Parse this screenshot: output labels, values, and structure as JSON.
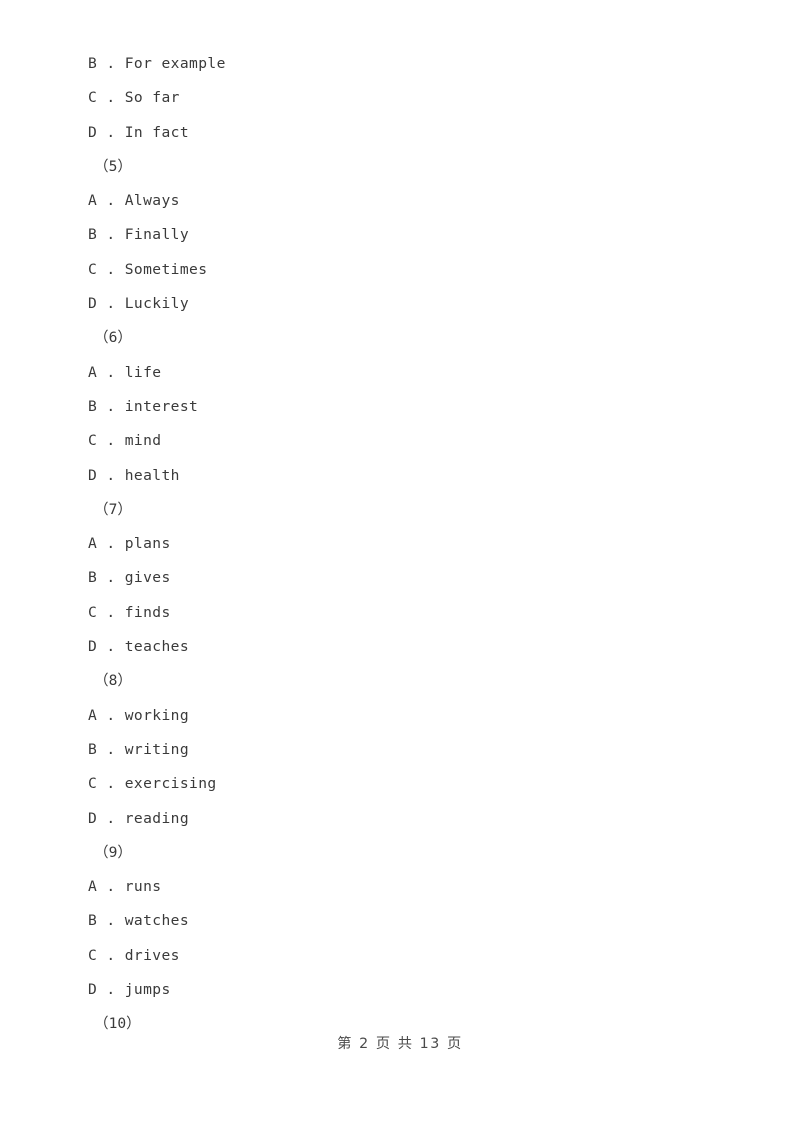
{
  "document": {
    "background_color": "#ffffff",
    "text_color": "#3a3a3a"
  },
  "blocks": [
    {
      "kind": "option",
      "letter": "B",
      "text": "For example",
      "full": "B . For example"
    },
    {
      "kind": "option",
      "letter": "C",
      "text": "So far",
      "full": "C . So far"
    },
    {
      "kind": "option",
      "letter": "D",
      "text": "In fact",
      "full": "D . In fact"
    },
    {
      "kind": "question",
      "number": "5",
      "full": "（5）"
    },
    {
      "kind": "option",
      "letter": "A",
      "text": "Always",
      "full": "A . Always"
    },
    {
      "kind": "option",
      "letter": "B",
      "text": "Finally",
      "full": "B . Finally"
    },
    {
      "kind": "option",
      "letter": "C",
      "text": "Sometimes",
      "full": "C . Sometimes"
    },
    {
      "kind": "option",
      "letter": "D",
      "text": "Luckily",
      "full": "D . Luckily"
    },
    {
      "kind": "question",
      "number": "6",
      "full": "（6）"
    },
    {
      "kind": "option",
      "letter": "A",
      "text": "life",
      "full": "A . life"
    },
    {
      "kind": "option",
      "letter": "B",
      "text": "interest",
      "full": "B . interest"
    },
    {
      "kind": "option",
      "letter": "C",
      "text": "mind",
      "full": "C . mind"
    },
    {
      "kind": "option",
      "letter": "D",
      "text": "health",
      "full": "D . health"
    },
    {
      "kind": "question",
      "number": "7",
      "full": "（7）"
    },
    {
      "kind": "option",
      "letter": "A",
      "text": "plans",
      "full": "A . plans"
    },
    {
      "kind": "option",
      "letter": "B",
      "text": "gives",
      "full": "B . gives"
    },
    {
      "kind": "option",
      "letter": "C",
      "text": "finds",
      "full": "C . finds"
    },
    {
      "kind": "option",
      "letter": "D",
      "text": "teaches",
      "full": "D . teaches"
    },
    {
      "kind": "question",
      "number": "8",
      "full": "（8）"
    },
    {
      "kind": "option",
      "letter": "A",
      "text": "working",
      "full": "A . working"
    },
    {
      "kind": "option",
      "letter": "B",
      "text": "writing",
      "full": "B . writing"
    },
    {
      "kind": "option",
      "letter": "C",
      "text": "exercising",
      "full": "C . exercising"
    },
    {
      "kind": "option",
      "letter": "D",
      "text": "reading",
      "full": "D . reading"
    },
    {
      "kind": "question",
      "number": "9",
      "full": "（9）"
    },
    {
      "kind": "option",
      "letter": "A",
      "text": "runs",
      "full": "A . runs"
    },
    {
      "kind": "option",
      "letter": "B",
      "text": "watches",
      "full": "B . watches"
    },
    {
      "kind": "option",
      "letter": "C",
      "text": "drives",
      "full": "C . drives"
    },
    {
      "kind": "option",
      "letter": "D",
      "text": "jumps",
      "full": "D . jumps"
    },
    {
      "kind": "question",
      "number": "10",
      "full": "（10）"
    }
  ],
  "footer": {
    "text": "第 2 页 共 13 页",
    "current_page": "2",
    "total_pages": "13"
  }
}
